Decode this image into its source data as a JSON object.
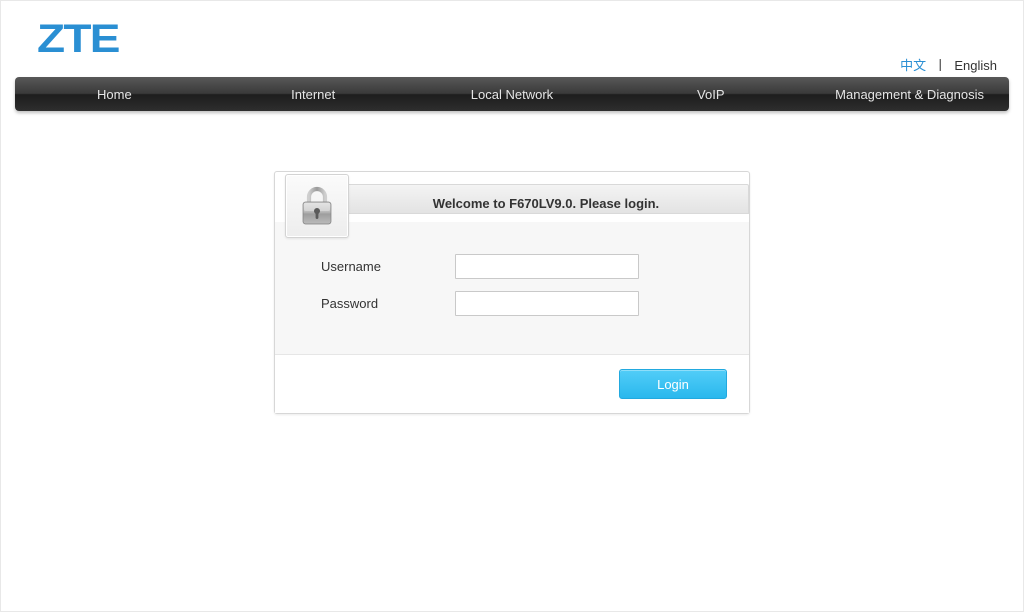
{
  "logo": "ZTE",
  "language": {
    "chinese": "中文",
    "english": "English"
  },
  "nav": {
    "items": [
      {
        "label": "Home"
      },
      {
        "label": "Internet"
      },
      {
        "label": "Local Network"
      },
      {
        "label": "VoIP"
      },
      {
        "label": "Management & Diagnosis"
      }
    ]
  },
  "login": {
    "title": "Welcome to F670LV9.0. Please login.",
    "username_label": "Username",
    "password_label": "Password",
    "username_value": "",
    "password_value": "",
    "button": "Login"
  }
}
